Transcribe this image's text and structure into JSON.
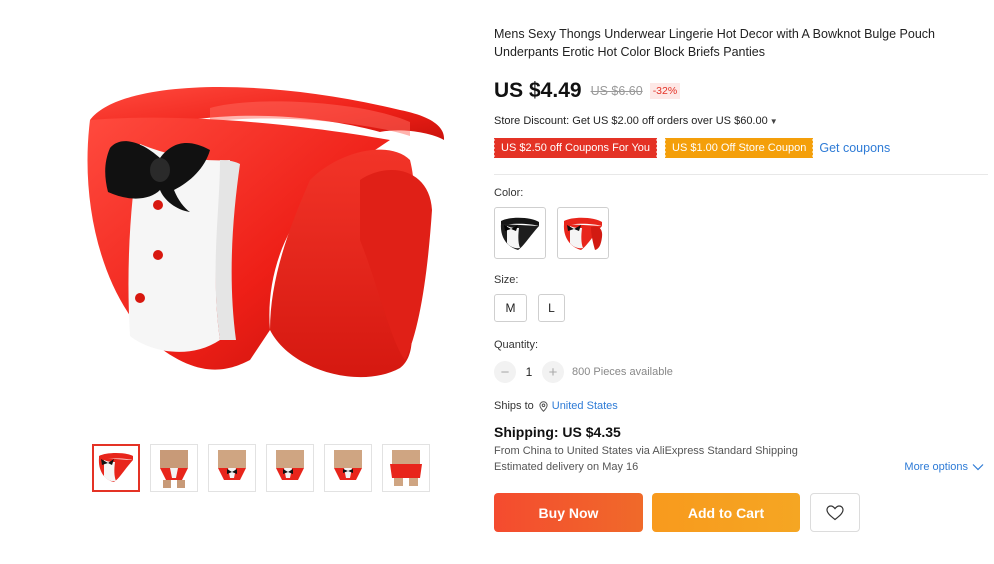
{
  "product": {
    "title": "Mens Sexy Thongs Underwear Lingerie Hot Decor with A Bowknot Bulge Pouch Underpants Erotic Hot Color Block Briefs Panties",
    "price": "US $4.49",
    "original_price": "US $6.60",
    "discount": "-32%",
    "store_discount": "Store Discount: Get US $2.00 off orders over US $60.00",
    "coupons": [
      "US $2.50 off Coupons For You",
      "US $1.00 Off Store Coupon"
    ],
    "get_coupons": "Get coupons"
  },
  "options": {
    "color_label": "Color:",
    "colors": [
      "black",
      "red"
    ],
    "size_label": "Size:",
    "sizes": [
      "M",
      "L"
    ],
    "quantity_label": "Quantity:",
    "quantity_value": "1",
    "quantity_available": "800 Pieces available"
  },
  "shipping": {
    "ships_to_label": "Ships to",
    "ships_to_value": "United States",
    "title": "Shipping: US $4.35",
    "route": "From China to United States via AliExpress Standard Shipping",
    "eta": "Estimated delivery on May 16",
    "more_options": "More options"
  },
  "actions": {
    "buy_now": "Buy Now",
    "add_to_cart": "Add to Cart"
  },
  "gallery": {
    "thumbnail_count": 6,
    "active_index": 0
  },
  "colors": {
    "accent_red": "#e43225",
    "accent_orange": "#f49f0a",
    "link_blue": "#2e7bd6",
    "buy_button": "#f44b2f",
    "cart_button": "#f89a1d"
  },
  "icons": {
    "location": "location-pin-icon",
    "more": "chevron-down-icon",
    "wishlist": "heart-icon",
    "minus": "minus-icon",
    "plus": "plus-icon"
  }
}
